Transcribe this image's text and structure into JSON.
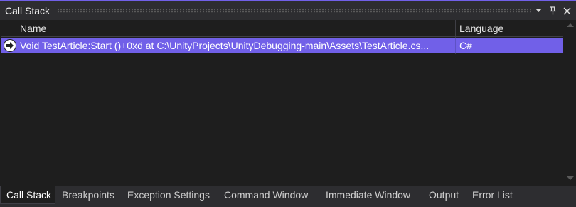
{
  "window": {
    "title": "Call Stack",
    "icons": [
      "chevron-down-icon",
      "pin-icon",
      "close-icon"
    ],
    "accent_color": "#7160e8"
  },
  "grid": {
    "columns": {
      "name": "Name",
      "language": "Language"
    },
    "rows": [
      {
        "icon": "current-frame-arrow-icon",
        "name": "Void TestArticle:Start ()+0xd at C:\\UnityProjects\\UnityDebugging-main\\Assets\\TestArticle.cs...",
        "language": "C#"
      }
    ]
  },
  "tabs": [
    {
      "label": "Call Stack",
      "active": true
    },
    {
      "label": "Breakpoints",
      "active": false
    },
    {
      "label": "Exception Settings",
      "active": false
    },
    {
      "label": "Command Window",
      "active": false
    },
    {
      "label": "Immediate Window",
      "active": false
    },
    {
      "label": "Output",
      "active": false
    },
    {
      "label": "Error List",
      "active": false
    }
  ]
}
